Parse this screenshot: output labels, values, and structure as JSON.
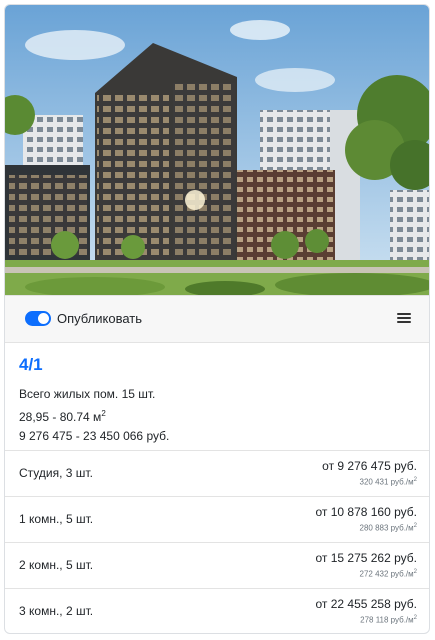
{
  "toolbar": {
    "publish_label": "Опубликовать",
    "publish_enabled": true,
    "accent": "#0d6efd",
    "menu_icon": "hamburger-menu-icon"
  },
  "summary": {
    "title": "4/1",
    "total_rooms": "Всего жилых пом. 15 шт.",
    "area_range": "28,95 - 80.74 м",
    "area_unit_sup": "2",
    "price_range": "9 276 475 - 23 450 066 руб."
  },
  "rows": [
    {
      "label": "Студия, 3 шт.",
      "price": "от 9 276 475 руб.",
      "ppm": "320 431 руб./м"
    },
    {
      "label": "1 комн., 5 шт.",
      "price": "от 10 878 160 руб.",
      "ppm": "280 883 руб./м"
    },
    {
      "label": "2 комн., 5 шт.",
      "price": "от 15 275 262 руб.",
      "ppm": "272 432 руб./м"
    },
    {
      "label": "3 комн., 2 шт.",
      "price": "от 22 455 258 руб.",
      "ppm": "278 118 руб./м"
    }
  ],
  "ppm_unit_sup": "2"
}
